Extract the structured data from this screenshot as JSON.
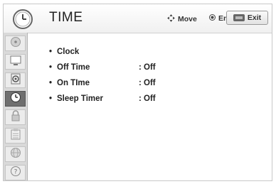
{
  "header": {
    "title": "TIME",
    "move_label": "Move",
    "enter_label": "Enter",
    "exit_label": "Exit",
    "icon": "clock-icon"
  },
  "sidebar": {
    "items": [
      {
        "name": "picture-menu",
        "icon": "disc-icon",
        "active": false
      },
      {
        "name": "screen-menu",
        "icon": "monitor-icon",
        "active": false
      },
      {
        "name": "audio-menu",
        "icon": "speaker-icon",
        "active": false
      },
      {
        "name": "time-menu",
        "icon": "clock-icon",
        "active": true
      },
      {
        "name": "lock-menu",
        "icon": "lock-icon",
        "active": false
      },
      {
        "name": "option-menu",
        "icon": "clipboard-icon",
        "active": false
      },
      {
        "name": "network-menu",
        "icon": "globe-icon",
        "active": false
      },
      {
        "name": "help-menu",
        "icon": "help-icon",
        "active": false
      }
    ]
  },
  "menu": {
    "items": [
      {
        "label": "Clock",
        "value": ""
      },
      {
        "label": "Off Time",
        "value": ": Off"
      },
      {
        "label": "On TIme",
        "value": ": Off"
      },
      {
        "label": "Sleep Timer",
        "value": ": Off"
      }
    ]
  },
  "colors": {
    "sidebar_bg": "#d9d9d9",
    "active_item": "#6f6f6f",
    "text": "#222222"
  }
}
